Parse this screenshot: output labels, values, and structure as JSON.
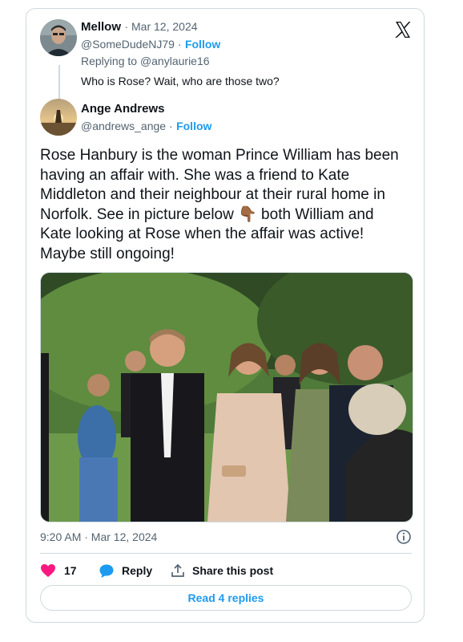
{
  "reply_tweet": {
    "name": "Mellow",
    "date": "· Mar 12, 2024",
    "handle": "@SomeDudeNJ79 ·",
    "follow": "Follow",
    "replying_prefix": "Replying to",
    "replying_to": "@anylaurie16",
    "text": "Who is Rose? Wait, who are those two?"
  },
  "main_tweet": {
    "name": "Ange Andrews",
    "handle": "@andrews_ange ·",
    "follow": "Follow",
    "text_lines": [
      "Rose Hanbury is the woman Prince William has been",
      "having an affair with. She was a friend to Kate",
      "Middleton and their neighbour at their rural home in",
      "Norfolk. See in picture below 👇🏾 both William and",
      "Kate looking at Rose when the affair was active!",
      "Maybe still ongoing!"
    ],
    "timestamp": "9:20 AM · Mar 12, 2024"
  },
  "actions": {
    "likes": "17",
    "reply_label": "Reply",
    "share_label": "Share this post"
  },
  "read_replies": "Read 4 replies",
  "colors": {
    "accent": "#1d9bf0",
    "like": "#f91880",
    "border": "#cfd9de",
    "muted": "#536471"
  },
  "icons": [
    "x-logo-icon",
    "info-icon",
    "heart-icon",
    "reply-bubble-icon",
    "share-icon"
  ]
}
